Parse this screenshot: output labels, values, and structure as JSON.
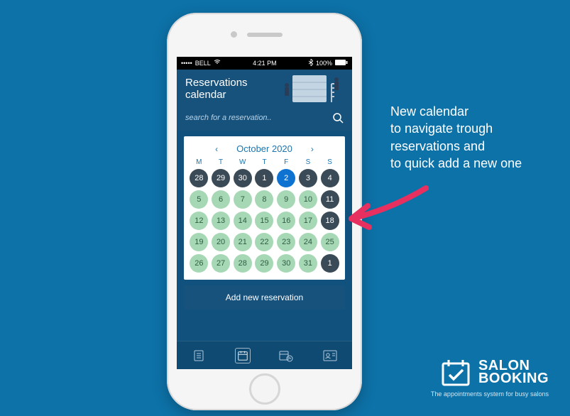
{
  "statusbar": {
    "carrier": "BELL",
    "time": "4:21 PM",
    "battery": "100%"
  },
  "header": {
    "title_line1": "Reservations",
    "title_line2": "calendar"
  },
  "search": {
    "placeholder": "search for a reservation.."
  },
  "calendar": {
    "month_label": "October 2020",
    "dow": [
      "M",
      "T",
      "W",
      "T",
      "F",
      "S",
      "S"
    ],
    "weeks": [
      [
        {
          "n": "28",
          "style": "dark"
        },
        {
          "n": "29",
          "style": "dark"
        },
        {
          "n": "30",
          "style": "dark"
        },
        {
          "n": "1",
          "style": "dark"
        },
        {
          "n": "2",
          "style": "sel"
        },
        {
          "n": "3",
          "style": "dark"
        },
        {
          "n": "4",
          "style": "dark"
        }
      ],
      [
        {
          "n": "5",
          "style": "green"
        },
        {
          "n": "6",
          "style": "green"
        },
        {
          "n": "7",
          "style": "green"
        },
        {
          "n": "8",
          "style": "green"
        },
        {
          "n": "9",
          "style": "green"
        },
        {
          "n": "10",
          "style": "green"
        },
        {
          "n": "11",
          "style": "dark"
        }
      ],
      [
        {
          "n": "12",
          "style": "green"
        },
        {
          "n": "13",
          "style": "green"
        },
        {
          "n": "14",
          "style": "green"
        },
        {
          "n": "15",
          "style": "green"
        },
        {
          "n": "16",
          "style": "green"
        },
        {
          "n": "17",
          "style": "green"
        },
        {
          "n": "18",
          "style": "dark"
        }
      ],
      [
        {
          "n": "19",
          "style": "green"
        },
        {
          "n": "20",
          "style": "green"
        },
        {
          "n": "21",
          "style": "green"
        },
        {
          "n": "22",
          "style": "green"
        },
        {
          "n": "23",
          "style": "green"
        },
        {
          "n": "24",
          "style": "green"
        },
        {
          "n": "25",
          "style": "green"
        }
      ],
      [
        {
          "n": "26",
          "style": "green"
        },
        {
          "n": "27",
          "style": "green"
        },
        {
          "n": "28",
          "style": "green"
        },
        {
          "n": "29",
          "style": "green"
        },
        {
          "n": "30",
          "style": "green"
        },
        {
          "n": "31",
          "style": "green"
        },
        {
          "n": "1",
          "style": "dark"
        }
      ]
    ]
  },
  "add_button": "Add new reservation",
  "annotation": {
    "line1": "New calendar",
    "line2": "to navigate trough",
    "line3": "reservations and",
    "line4": "to quick add a new one"
  },
  "brand": {
    "word1": "SALON",
    "word2": "BOOKING",
    "tagline": "The appointments system for busy salons"
  },
  "colors": {
    "bg": "#0d72a8",
    "header": "#17527d",
    "arrow": "#e7305f"
  }
}
